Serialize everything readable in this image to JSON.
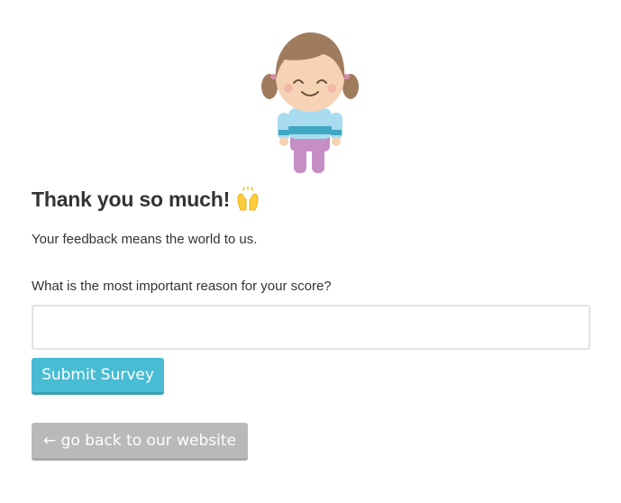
{
  "thanks": {
    "heading": "Thank you so much!",
    "emoji_icon": "raising-hands-icon",
    "message": "Your feedback means the world to us."
  },
  "survey": {
    "question": "What is the most important reason for your score?",
    "answer_value": "",
    "submit_label": "Submit Survey"
  },
  "navigation": {
    "back_label": "← go back to our website"
  },
  "illustration_icon": "smiling-girl-illustration",
  "colors": {
    "submit_button": "#48bcd3",
    "back_button": "#b9b9b9",
    "input_border": "#e2e2e2",
    "text": "#333333"
  }
}
